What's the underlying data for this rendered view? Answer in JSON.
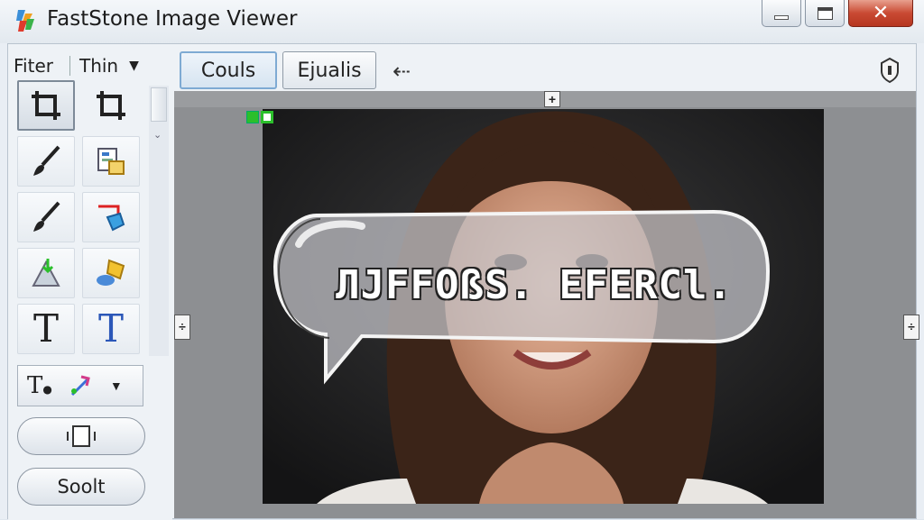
{
  "window": {
    "title": "FastStone Image Viewer"
  },
  "left_panel": {
    "filter_label": "Fiter",
    "thin_label": "Thin",
    "tools": [
      {
        "name": "crop-tool-active",
        "icon": "crop-icon"
      },
      {
        "name": "crop-tool",
        "icon": "crop-icon"
      },
      {
        "name": "brush-tool",
        "icon": "brush-icon"
      },
      {
        "name": "clone-tool",
        "icon": "clone-stamp-icon"
      },
      {
        "name": "paint-tool",
        "icon": "paintbrush-icon"
      },
      {
        "name": "shape-tool",
        "icon": "shape-arrow-icon"
      },
      {
        "name": "select-tool",
        "icon": "select-arrow-icon"
      },
      {
        "name": "objects-tool",
        "icon": "objects-icon"
      },
      {
        "name": "text-tool",
        "icon": "text-t-icon"
      },
      {
        "name": "text-color-tool",
        "icon": "text-t-blue-icon"
      }
    ],
    "bottom_button_label": "Soolt"
  },
  "top_toolbar": {
    "button1_label": "Couls",
    "button2_label": "Ejualis"
  },
  "canvas": {
    "bubble_text": "ЛJFFOßS. EFERCl."
  },
  "colors": {
    "accent_selected": "#7eaad3",
    "close_button": "#c94a33",
    "badge_green": "#2bbf2b",
    "canvas_bg": "#8d8f92"
  }
}
